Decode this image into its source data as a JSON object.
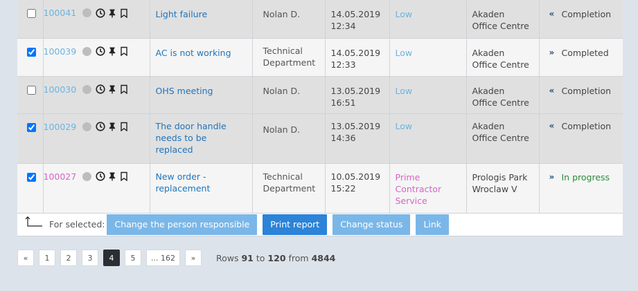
{
  "rows": [
    {
      "id": "100041",
      "checked": false,
      "subject": "Light failure",
      "person": "Nolan D.",
      "date": "14.05.2019",
      "time": "12:34",
      "priority": "Low",
      "location_l1": "Akaden",
      "location_l2": "Office Centre",
      "status": "Completion",
      "status_icon": "double-chevron-left"
    },
    {
      "id": "100039",
      "checked": true,
      "subject": "AC is not working",
      "person_l1": "Technical",
      "person_l2": "Department",
      "date": "14.05.2019",
      "time": "12:33",
      "priority": "Low",
      "location_l1": "Akaden",
      "location_l2": "Office Centre",
      "status": "Completed",
      "status_icon": "double-chevron-right"
    },
    {
      "id": "100030",
      "checked": false,
      "subject": "OHS meeting",
      "person": "Nolan D.",
      "date": "13.05.2019",
      "time": "16:51",
      "priority": "Low",
      "location_l1": "Akaden",
      "location_l2": "Office Centre",
      "status": "Completion",
      "status_icon": "double-chevron-left"
    },
    {
      "id": "100029",
      "checked": true,
      "subject_l1": "The door handle",
      "subject_l2": "needs to be",
      "subject_l3": "replaced",
      "person": "Nolan D.",
      "date": "13.05.2019",
      "time": "14:36",
      "priority": "Low",
      "location_l1": "Akaden",
      "location_l2": "Office Centre",
      "status": "Completion",
      "status_icon": "double-chevron-left"
    },
    {
      "id": "100027",
      "checked": true,
      "subject_l1": "New order -",
      "subject_l2": "replacement",
      "person_l1": "Technical",
      "person_l2": "Department",
      "date": "10.05.2019",
      "time": "15:22",
      "priority_l1": "Prime",
      "priority_l2": "Contractor",
      "priority_l3": "Service",
      "location_l1": "Prologis Park",
      "location_l2": "Wroclaw V",
      "status": "In progress",
      "status_icon": "double-chevron-right"
    }
  ],
  "toolbar": {
    "for_selected_label": "For selected:",
    "change_person_label": "Change the person responsible",
    "print_report_label": "Print report",
    "change_status_label": "Change status",
    "link_label": "Link"
  },
  "pagination": {
    "prev": "«",
    "pages": [
      "1",
      "2",
      "3",
      "4",
      "5",
      "... 162"
    ],
    "active": "4",
    "next": "»",
    "rows_prefix": "Rows",
    "rows_from": "91",
    "rows_to_word": "to",
    "rows_to": "120",
    "rows_from_word": "from",
    "rows_total": "4844"
  },
  "colors": {
    "link_blue": "#1f74bb",
    "id_blue": "#6ab4e0",
    "pink": "#d863c8",
    "green_status": "#2e8b3a",
    "button_light": "#7ab7e8",
    "button_dark": "#2c83d8"
  }
}
